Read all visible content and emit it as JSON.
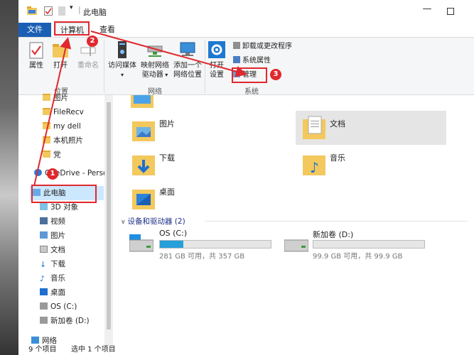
{
  "title": "此电脑",
  "tabs": {
    "file": "文件",
    "computer": "计算机",
    "view": "查看"
  },
  "ribbon": {
    "properties": "属性",
    "open": "打开",
    "rename": "重命名",
    "location_group": "位置",
    "access_media": "访问媒体",
    "map_drive_line1": "映射网络",
    "map_drive_line2": "驱动器",
    "add_location_line1": "添加一个",
    "add_location_line2": "网络位置",
    "network_group": "网络",
    "open_settings_line1": "打开",
    "open_settings_line2": "设置",
    "uninstall": "卸载或更改程序",
    "system_properties": "系统属性",
    "manage": "管理",
    "system_group": "系统"
  },
  "nav": {
    "items": [
      {
        "label": "图片"
      },
      {
        "label": "FileRecv"
      },
      {
        "label": "my dell"
      },
      {
        "label": "本机照片"
      },
      {
        "label": "党"
      },
      {
        "label": "OneDrive - Perso"
      },
      {
        "label": "此电脑"
      },
      {
        "label": "3D 对象"
      },
      {
        "label": "视频"
      },
      {
        "label": "图片"
      },
      {
        "label": "文档"
      },
      {
        "label": "下载"
      },
      {
        "label": "音乐"
      },
      {
        "label": "桌面"
      },
      {
        "label": "OS (C:)"
      },
      {
        "label": "新加卷 (D:)"
      },
      {
        "label": "网络"
      }
    ]
  },
  "folders": [
    {
      "label": "图片"
    },
    {
      "label": "文档"
    },
    {
      "label": "下载"
    },
    {
      "label": "音乐"
    },
    {
      "label": "桌面"
    }
  ],
  "devices_header": "设备和驱动器 (2)",
  "drives": [
    {
      "name": "OS (C:)",
      "size": "281 GB 可用，共 357 GB",
      "used_fraction": 0.21
    },
    {
      "name": "新加卷 (D:)",
      "size": "99.9 GB 可用，共 99.9 GB",
      "used_fraction": 0.0
    }
  ],
  "status": {
    "count": "9 个项目",
    "selected": "选中 1 个项目"
  },
  "annotations": {
    "b1": "1",
    "b2": "2",
    "b3": "3"
  },
  "colors": {
    "accent": "#1b5fb5",
    "annotation": "#e0282e",
    "drive_fill": "#26a0da",
    "folder": "#f3c85d"
  }
}
